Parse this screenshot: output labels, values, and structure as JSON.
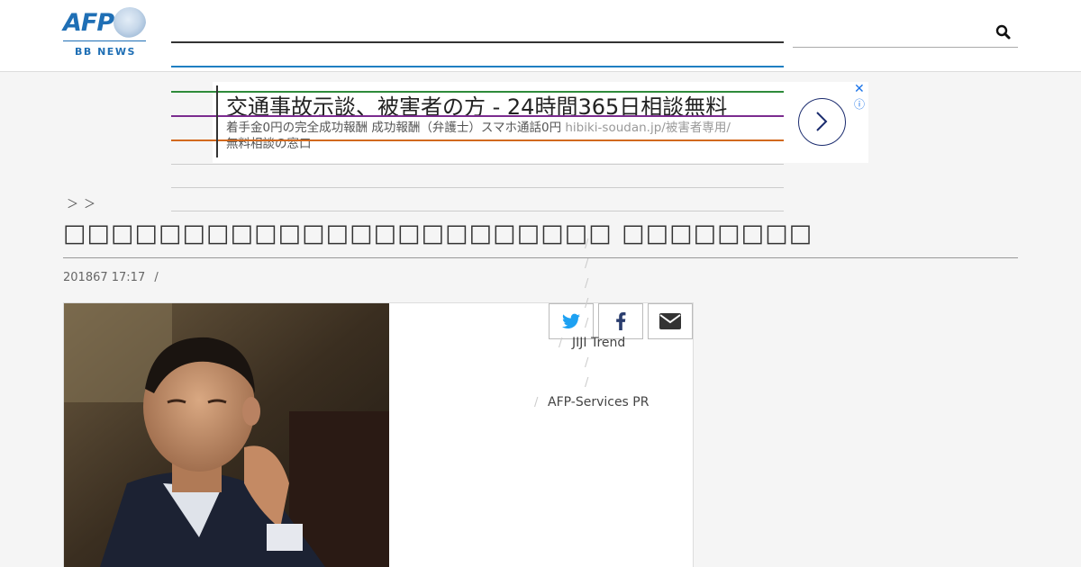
{
  "header": {
    "logo_text": "AFP",
    "logo_subtext": "BB NEWS"
  },
  "ad": {
    "title": "交通事故示談、被害者の方 - 24時間365日相談無料",
    "description": "着手金0円の完全成功報酬 成功報酬（弁護士）スマホ通話0円 ",
    "url": "hibiki-soudan.jp/被害者専用/",
    "description2": "無料相談の窓口",
    "close_glyph": "✕",
    "info_glyph": "ⓘ"
  },
  "breadcrumb": "＞＞",
  "article": {
    "title": "□□□□□□□□□□□□□□□□□□□□□□□ □□□□□□□□",
    "date": "201867 17:17",
    "date_separator": "/"
  },
  "share": {
    "twitter_icon": "twitter-icon",
    "facebook_icon": "facebook-icon",
    "email_icon": "envelope-icon"
  },
  "sidebar": {
    "slash": "/",
    "links": [
      "JIJI Trend",
      "AFP-Services PR"
    ]
  },
  "colors": {
    "brand_blue": "#1f6fb5",
    "nav_green": "#2e8b3a",
    "nav_purple": "#7b2c8f",
    "nav_orange": "#d2691e"
  }
}
